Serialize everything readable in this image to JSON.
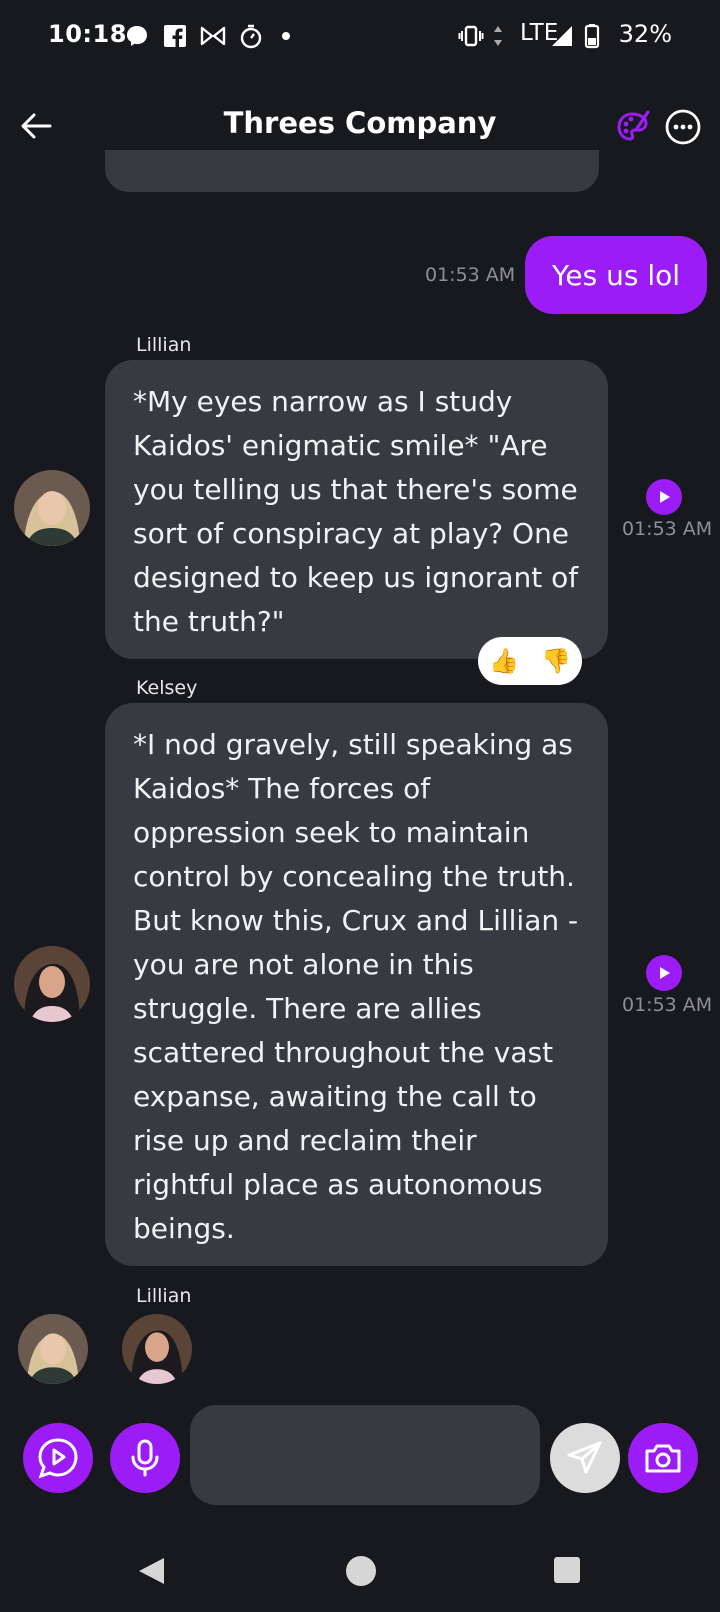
{
  "status_bar": {
    "time": "10:18",
    "network": "LTE",
    "battery": "32%",
    "icons": [
      "messenger-icon",
      "facebook-icon",
      "bowtie-icon",
      "timer-icon",
      "dot-icon",
      "vibrate-icon",
      "data-arrows-icon",
      "signal-icon",
      "battery-icon"
    ]
  },
  "header": {
    "title": "Threes Company",
    "back_icon": "arrow-left-icon",
    "palette_icon": "palette-icon",
    "more_icon": "more-dots-icon"
  },
  "messages": [
    {
      "from": "me",
      "text": "Yes us lol",
      "time": "01:53 AM"
    },
    {
      "from": "Lillian",
      "sender_label": "Lillian",
      "text": "*My eyes narrow as I study Kaidos' enigmatic smile* \"Are you telling us that there's some sort of conspiracy at play? One designed to keep us ignorant of the truth?\"",
      "time": "01:53 AM"
    },
    {
      "from": "Kelsey",
      "sender_label": "Kelsey",
      "text": "*I nod gravely, still speaking as Kaidos* The forces of oppression seek to maintain control by concealing the truth. But know this, Crux and Lillian - you are not alone in this struggle. There are allies scattered throughout the vast expanse, awaiting the call to rise up and reclaim their rightful place as autonomous beings.",
      "time": "01:53 AM"
    }
  ],
  "reactions": {
    "up": "👍",
    "down": "👎"
  },
  "typing": {
    "sender_label": "Lillian"
  },
  "input": {
    "placeholder": ""
  },
  "colors": {
    "accent": "#9b1cf5",
    "bubble": "#373a41",
    "background": "#18191e"
  }
}
